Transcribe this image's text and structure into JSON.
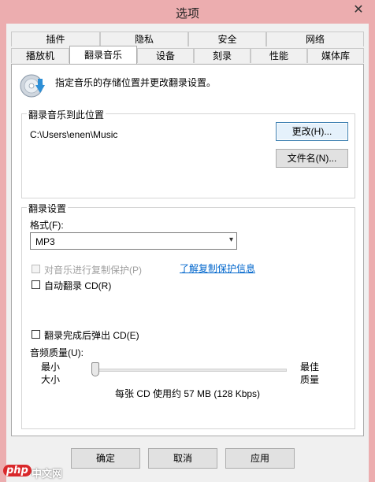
{
  "window": {
    "title": "选项"
  },
  "tabs": {
    "row1": [
      "插件",
      "隐私",
      "安全",
      "网络"
    ],
    "row2": [
      "播放机",
      "翻录音乐",
      "设备",
      "刻录",
      "性能",
      "媒体库"
    ],
    "selected": "翻录音乐"
  },
  "panel": {
    "description": "指定音乐的存储位置并更改翻录设置。",
    "location_group": {
      "title": "翻录音乐到此位置",
      "path": "C:\\Users\\enen\\Music",
      "change_button": "更改(H)...",
      "filename_button": "文件名(N)..."
    },
    "settings_group": {
      "title": "翻录设置",
      "format_label": "格式(F):",
      "format_value": "MP3",
      "copy_protect_label": "对音乐进行复制保护(P)",
      "copy_protect_link": "了解复制保护信息",
      "auto_rip_label": "自动翻录 CD(R)",
      "eject_label": "翻录完成后弹出 CD(E)",
      "quality_label": "音频质量(U):",
      "quality_min_line1": "最小",
      "quality_min_line2": "大小",
      "quality_max_line1": "最佳",
      "quality_max_line2": "质量",
      "quality_level": 0,
      "quality_info": "每张 CD 使用约 57 MB (128 Kbps)"
    }
  },
  "buttons": {
    "ok": "确定",
    "cancel": "取消",
    "apply": "应用"
  },
  "watermark": {
    "brand": "php",
    "site": "中文网"
  }
}
